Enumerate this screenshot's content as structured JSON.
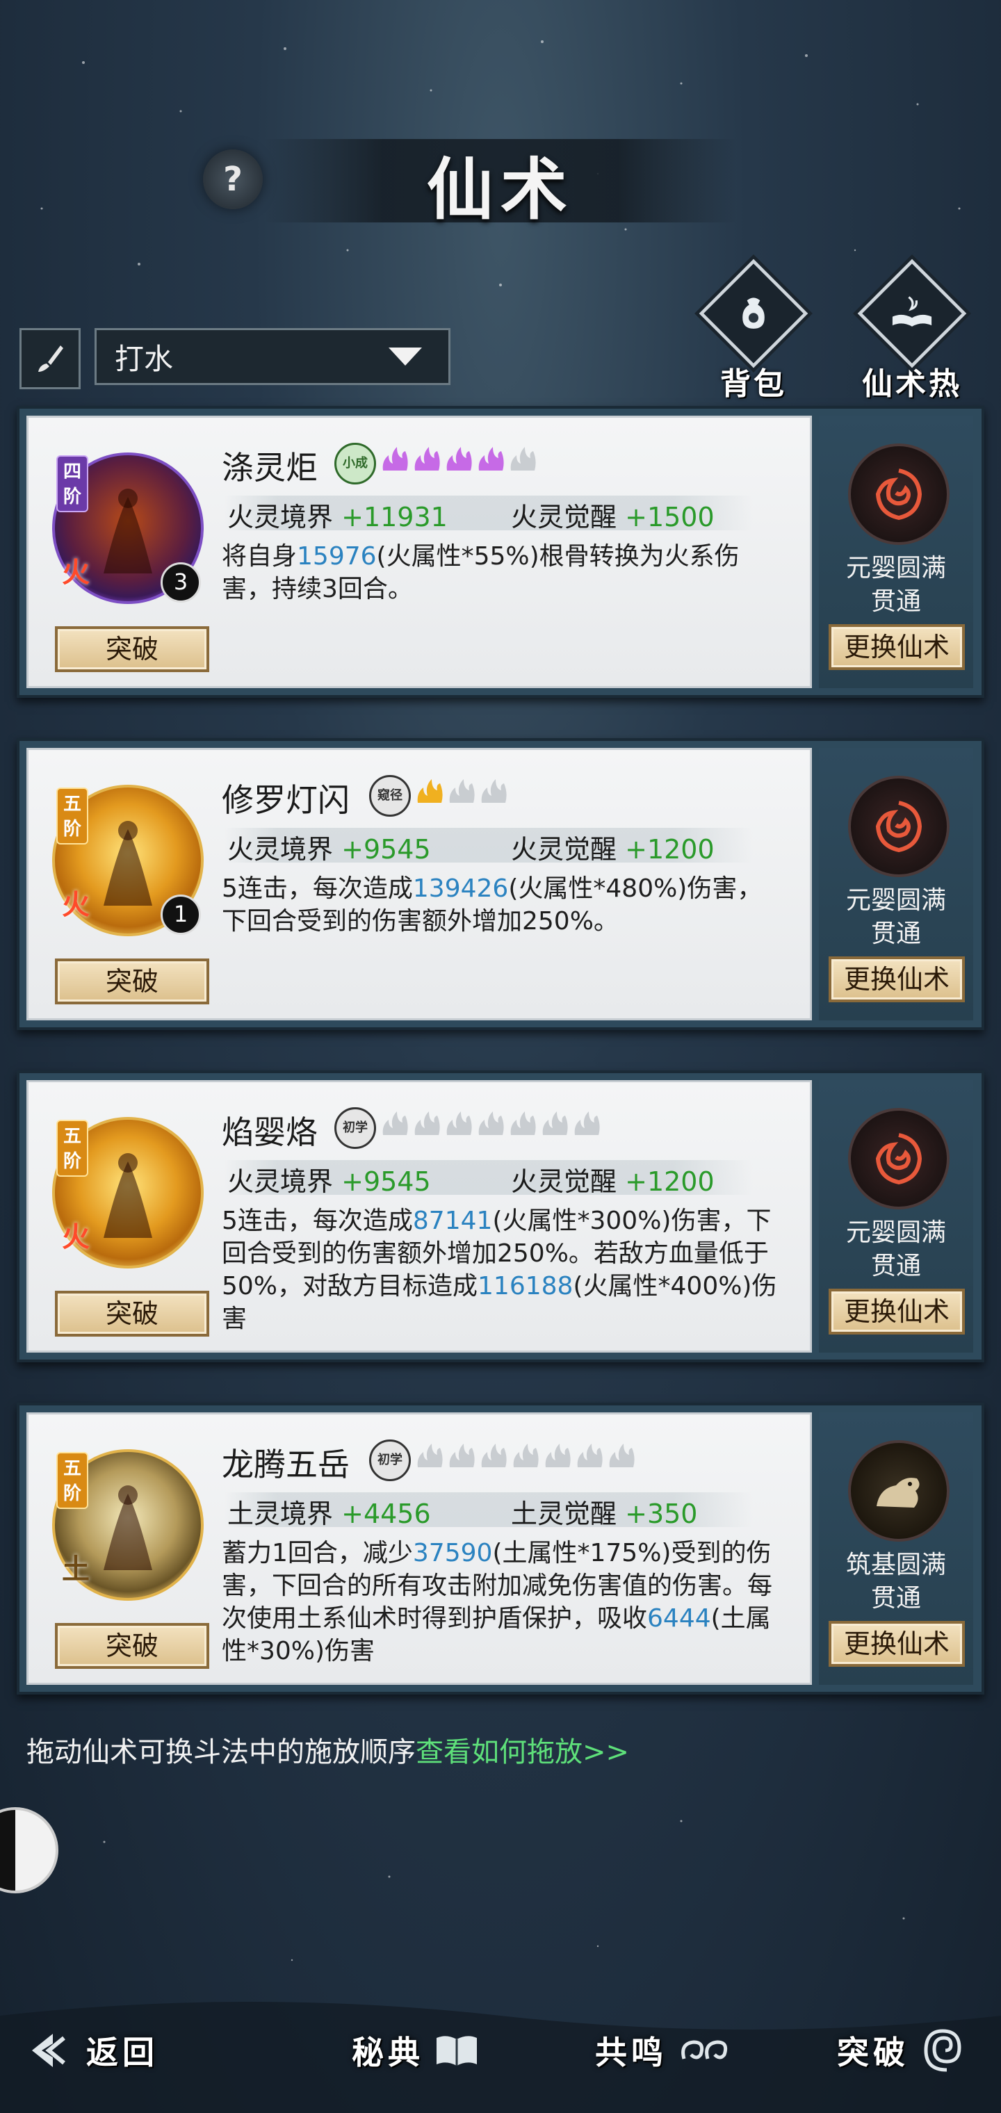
{
  "header": {
    "title": "仙术",
    "help_label": "?"
  },
  "filter": {
    "selected": "打水"
  },
  "side_buttons": {
    "bag": "背包",
    "heat": "仙术热度"
  },
  "skills": [
    {
      "tier": "四阶",
      "element": "火",
      "count": "3",
      "name": "涤灵炬",
      "rank": "小成",
      "flames_lit": 4,
      "flames_total": 5,
      "stat1_label": "火灵境界",
      "stat1_value": "+11931",
      "stat2_label": "火灵觉醒",
      "stat2_value": "+1500",
      "desc": [
        {
          "t": "将自身"
        },
        {
          "n": "15976"
        },
        {
          "t": "(火属性*55%)根骨转换为火系伤害，持续3回合。"
        }
      ],
      "break_label": "突破",
      "side_line1": "元婴圆满",
      "side_line2": "贯通",
      "change_label": "更换仙术"
    },
    {
      "tier": "五阶",
      "element": "火",
      "count": "1",
      "name": "修罗灯闪",
      "rank": "窥径",
      "flames_lit": 1,
      "flames_total": 3,
      "stat1_label": "火灵境界",
      "stat1_value": "+9545",
      "stat2_label": "火灵觉醒",
      "stat2_value": "+1200",
      "desc": [
        {
          "t": "5连击，每次造成"
        },
        {
          "n": "139426"
        },
        {
          "t": "(火属性*480%)伤害，下回合受到的伤害额外增加250%。"
        }
      ],
      "break_label": "突破",
      "side_line1": "元婴圆满",
      "side_line2": "贯通",
      "change_label": "更换仙术"
    },
    {
      "tier": "五阶",
      "element": "火",
      "count": "",
      "name": "焰婴烙",
      "rank": "初学",
      "flames_lit": 0,
      "flames_total": 7,
      "stat1_label": "火灵境界",
      "stat1_value": "+9545",
      "stat2_label": "火灵觉醒",
      "stat2_value": "+1200",
      "desc": [
        {
          "t": "5连击，每次造成"
        },
        {
          "n": "87141"
        },
        {
          "t": "(火属性*300%)伤害，下回合受到的伤害额外增加250%。若敌方血量低于50%，对敌方目标造成"
        },
        {
          "n": "116188"
        },
        {
          "t": "(火属性*400%)伤害"
        }
      ],
      "break_label": "突破",
      "side_line1": "元婴圆满",
      "side_line2": "贯通",
      "change_label": "更换仙术"
    },
    {
      "tier": "五阶",
      "element": "土",
      "count": "",
      "name": "龙腾五岳",
      "rank": "初学",
      "flames_lit": 0,
      "flames_total": 7,
      "stat1_label": "土灵境界",
      "stat1_value": "+4456",
      "stat2_label": "土灵觉醒",
      "stat2_value": "+350",
      "desc": [
        {
          "t": "蓄力1回合，减少"
        },
        {
          "n": "37590"
        },
        {
          "t": "(土属性*175%)受到的伤害，下回合的所有攻击附加减免伤害值的伤害。每次使用土系仙术时得到护盾保护，吸收"
        },
        {
          "n": "6444"
        },
        {
          "t": "(土属性*30%)伤害"
        }
      ],
      "break_label": "突破",
      "side_line1": "筑基圆满",
      "side_line2": "贯通",
      "change_label": "更换仙术"
    }
  ],
  "hint": {
    "text": "拖动仙术可换斗法中的施放顺序",
    "link": "查看如何拖放>>"
  },
  "bottom_nav": {
    "back": "返回",
    "secret": "秘典",
    "resonance": "共鸣",
    "breakthrough": "突破"
  },
  "colors": {
    "plus_green": "#2a9a2a",
    "number_blue": "#2a82c0",
    "link_green": "#5ee07a"
  }
}
